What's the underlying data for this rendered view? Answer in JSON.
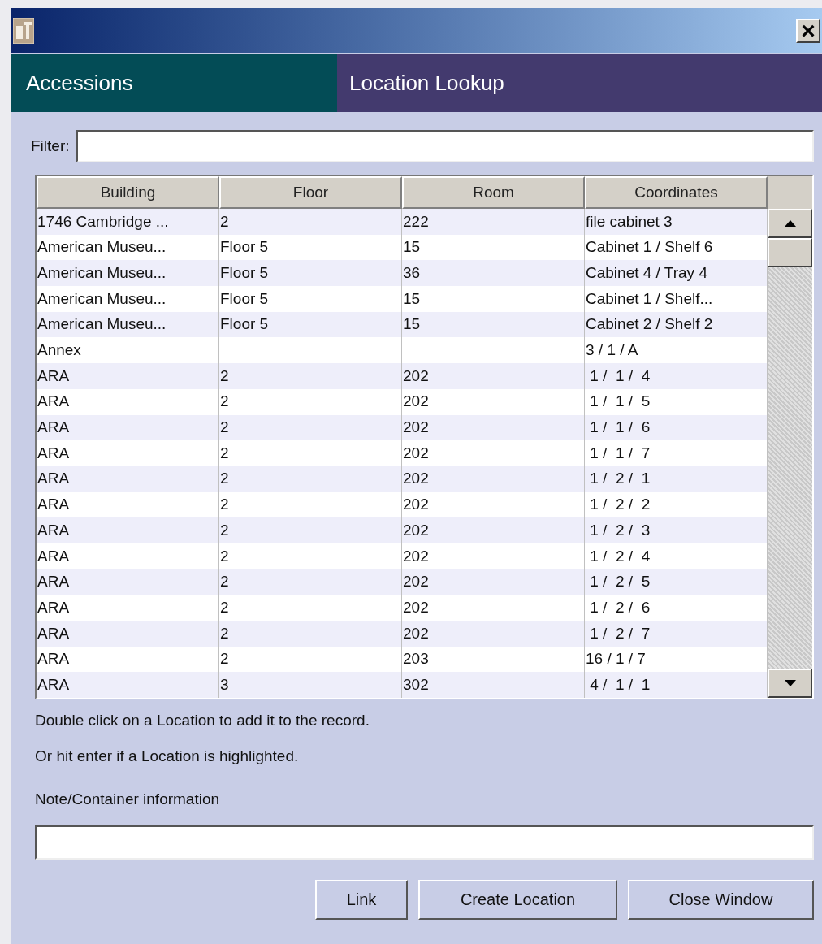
{
  "window": {
    "close_button": "×"
  },
  "header": {
    "section": "Accessions",
    "title": "Location Lookup"
  },
  "filter": {
    "label": "Filter:"
  },
  "table": {
    "columns": [
      "Building",
      "Floor",
      "Room",
      "Coordinates"
    ],
    "rows": [
      {
        "cells": [
          "1746 Cambridge ...",
          "2",
          "222",
          "file cabinet 3"
        ]
      },
      {
        "cells": [
          "American Museu...",
          "Floor 5",
          "15",
          "Cabinet 1 / Shelf 6"
        ]
      },
      {
        "cells": [
          "American Museu...",
          "Floor 5",
          "36",
          "Cabinet 4 / Tray 4"
        ]
      },
      {
        "cells": [
          "American Museu...",
          "Floor 5",
          "15",
          "Cabinet 1 / Shelf..."
        ]
      },
      {
        "cells": [
          "American Museu...",
          "Floor 5",
          "15",
          "Cabinet 2 / Shelf 2"
        ]
      },
      {
        "cells": [
          "Annex",
          "",
          "",
          "3 / 1 / A"
        ]
      },
      {
        "cells": [
          "ARA",
          "2",
          "202",
          " 1 /  1 /  4"
        ]
      },
      {
        "cells": [
          "ARA",
          "2",
          "202",
          " 1 /  1 /  5"
        ]
      },
      {
        "cells": [
          "ARA",
          "2",
          "202",
          " 1 /  1 /  6"
        ]
      },
      {
        "cells": [
          "ARA",
          "2",
          "202",
          " 1 /  1 /  7"
        ]
      },
      {
        "cells": [
          "ARA",
          "2",
          "202",
          " 1 /  2 /  1"
        ]
      },
      {
        "cells": [
          "ARA",
          "2",
          "202",
          " 1 /  2 /  2"
        ]
      },
      {
        "cells": [
          "ARA",
          "2",
          "202",
          " 1 /  2 /  3"
        ]
      },
      {
        "cells": [
          "ARA",
          "2",
          "202",
          " 1 /  2 /  4"
        ]
      },
      {
        "cells": [
          "ARA",
          "2",
          "202",
          " 1 /  2 /  5"
        ]
      },
      {
        "cells": [
          "ARA",
          "2",
          "202",
          " 1 /  2 /  6"
        ]
      },
      {
        "cells": [
          "ARA",
          "2",
          "202",
          " 1 /  2 /  7"
        ]
      },
      {
        "cells": [
          "ARA",
          "2",
          "203",
          "16 / 1 / 7"
        ]
      },
      {
        "cells": [
          "ARA",
          "3",
          "302",
          " 4 /  1 /  1"
        ]
      }
    ]
  },
  "hints": [
    "Double click on a Location to add it to the record.",
    "Or hit enter if a Location is highlighted."
  ],
  "note": {
    "label": "Note/Container information"
  },
  "buttons": [
    "Link",
    "Create Location",
    "Close Window"
  ]
}
